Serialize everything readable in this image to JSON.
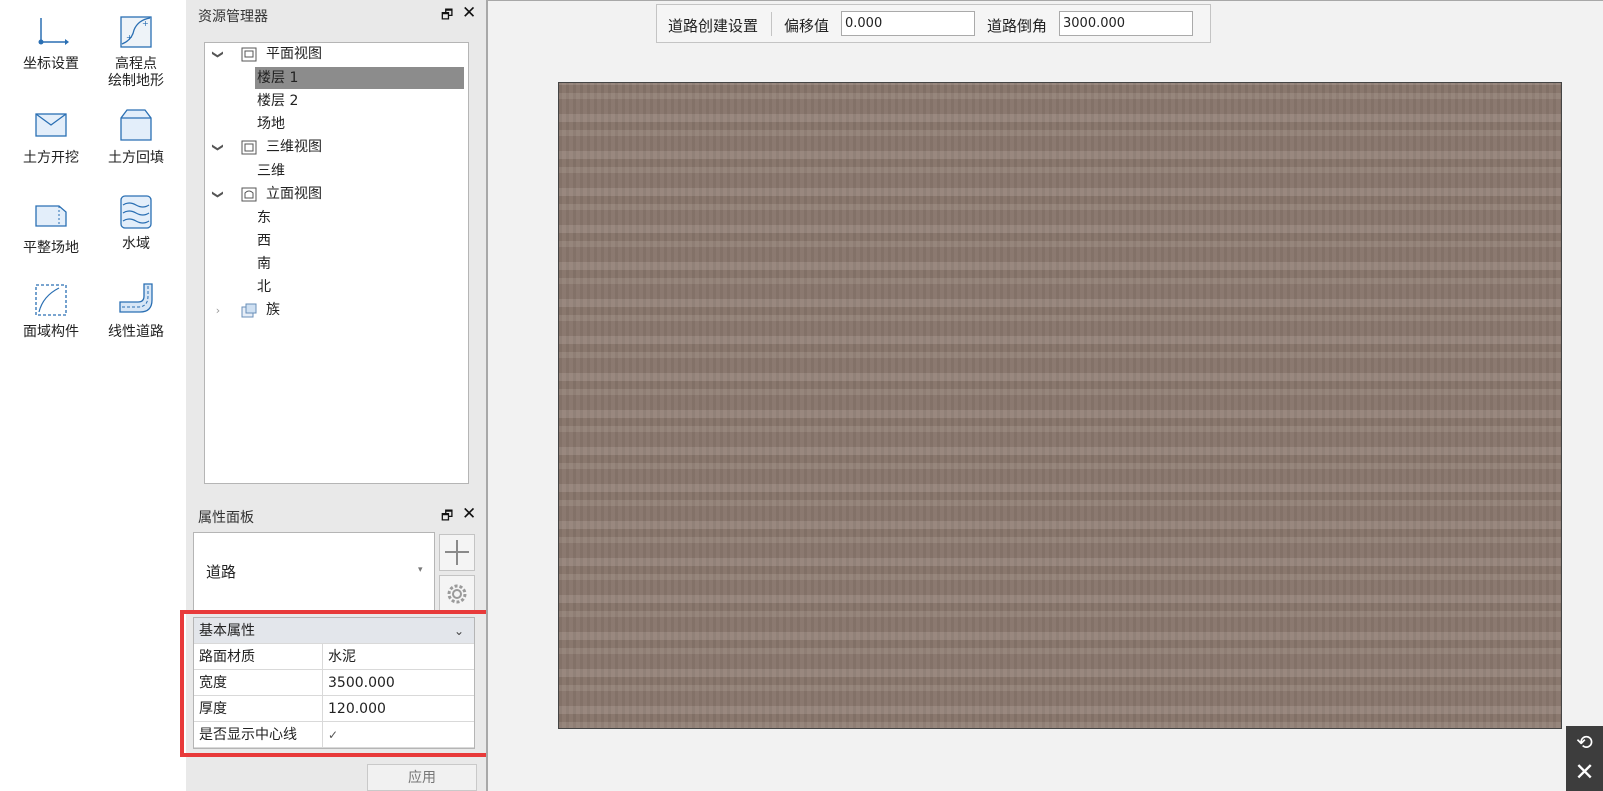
{
  "tools": [
    {
      "icon": "coordinate-icon",
      "label": "坐标设置"
    },
    {
      "icon": "elevation-terrain-icon",
      "label": "高程点\n绘制地形"
    },
    {
      "icon": "excavation-icon",
      "label": "土方开挖"
    },
    {
      "icon": "backfill-icon",
      "label": "土方回填"
    },
    {
      "icon": "level-site-icon",
      "label": "平整场地"
    },
    {
      "icon": "water-icon",
      "label": "水域"
    },
    {
      "icon": "area-component-icon",
      "label": "面域构件"
    },
    {
      "icon": "linear-road-icon",
      "label": "线性道路"
    }
  ],
  "resource_panel": {
    "title": "资源管理器",
    "tree": {
      "plan": {
        "label": "平面视图",
        "children": [
          "楼层 1",
          "楼层 2",
          "场地"
        ],
        "selected": "楼层 1"
      },
      "threed": {
        "label": "三维视图",
        "children": [
          "三维"
        ]
      },
      "elevation": {
        "label": "立面视图",
        "children": [
          "东",
          "西",
          "南",
          "北"
        ]
      },
      "family": {
        "label": "族"
      }
    }
  },
  "property_panel": {
    "title": "属性面板",
    "type_value": "道路",
    "section_title": "基本属性",
    "rows": [
      {
        "key": "路面材质",
        "value": "水泥"
      },
      {
        "key": "宽度",
        "value": "3500.000"
      },
      {
        "key": "厚度",
        "value": "120.000"
      },
      {
        "key": "是否显示中心线",
        "value": "✓"
      }
    ],
    "apply_label": "应用"
  },
  "road_bar": {
    "title": "道路创建设置",
    "offset_label": "偏移值",
    "offset_value": "0.000",
    "chamfer_label": "道路倒角",
    "chamfer_value": "3000.000"
  },
  "colors": {
    "highlight": "#e83a3a",
    "terrain": "#8d7a70",
    "selected_row": "#8c8c8c"
  }
}
